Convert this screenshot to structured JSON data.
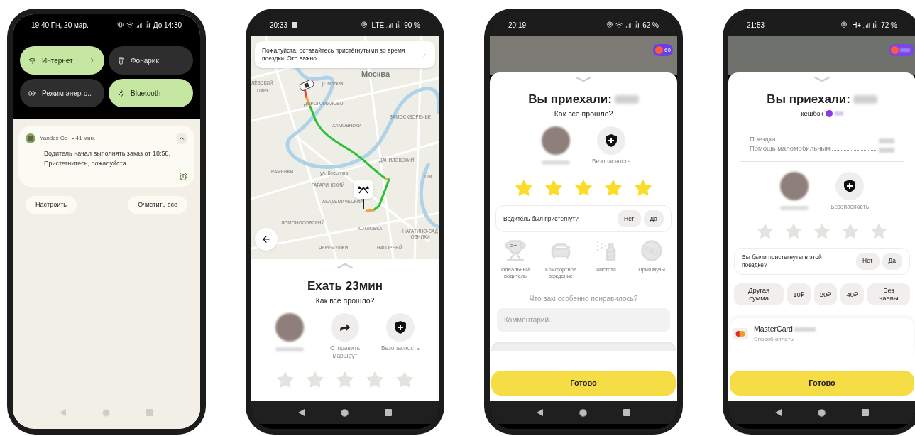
{
  "screens": [
    {
      "kind": "notification_shade",
      "status_bar": {
        "time": "19:40 Пн, 20 мар.",
        "battery": "До 14:30"
      },
      "tiles": [
        {
          "label": "Интернет",
          "on": true
        },
        {
          "label": "Фонарик",
          "on": false
        },
        {
          "label": "Режим энерго..",
          "on": false
        },
        {
          "label": "Bluetooth",
          "on": true
        }
      ],
      "notification": {
        "app": "Yandex Go",
        "age": "• 41 мин.",
        "text": "Водитель начал выполнять заказ от 18:58. Пристегнитесь, пожалуйста"
      },
      "buttons": [
        "Настроить",
        "Очистить все"
      ]
    },
    {
      "kind": "trip_map",
      "status_bar": {
        "time": "20:33",
        "network": "LTE",
        "battery": "90 %"
      },
      "banner": "Пожалуйста, оставайтесь пристёгнутыми во время поездки. Это важно",
      "map_labels": [
        "Москва",
        "ЛЁВСКИЙ",
        "р. Москва",
        "ПАРК",
        "ДОРОГОМИЛОВО",
        "ЗАМОСКВОРЕЧЬЕ",
        "ХАМОВНИКИ",
        "ДАНИЛОВСКИЙ",
        "РАМЕНКИ",
        "ул. Косыгина",
        "ТТК",
        "ГАГАРИНСКИЙ",
        "АКАДЕМИЧЕСКИЙ",
        "ЛОМОНОСОВСКИЙ",
        "КОТЛОВКА",
        "НАГАТИНО-САДОВНИКИ",
        "ЧЕРЁМУШКИ",
        "НАГОРНЫЙ"
      ],
      "title": "Ехать 23мин",
      "subtitle": "Как всё прошло?",
      "actions": [
        {
          "kind": "driver"
        },
        {
          "kind": "share",
          "label": "Отправить маршрут"
        },
        {
          "kind": "safety",
          "label": "Безопасность"
        }
      ],
      "stars": 0
    },
    {
      "kind": "trip_rating",
      "status_bar": {
        "time": "20:19",
        "battery": "62 %"
      },
      "plus_badge": "60",
      "title": "Вы приехали:",
      "subtitle": "Как всё прошло?",
      "actions": [
        {
          "kind": "driver"
        },
        {
          "kind": "safety",
          "label": "Безопасность"
        }
      ],
      "stars": 5,
      "seatbelt": {
        "question": "Водитель был пристёгнут?",
        "options": [
          "Нет",
          "Да"
        ]
      },
      "compliments": [
        {
          "label": "Идеальный водитель",
          "badge": "5+"
        },
        {
          "label": "Комфортное вождение"
        },
        {
          "label": "Чистота"
        },
        {
          "label": "Прия музы"
        }
      ],
      "prompt": "Что вам особенно понравилось?",
      "comment": {
        "placeholder": "Комментарий..."
      },
      "done": "Готово"
    },
    {
      "kind": "trip_tips",
      "status_bar": {
        "time": "21:53",
        "network": "H+",
        "battery": "72 %"
      },
      "title": "Вы приехали:",
      "cashback": "кешбэк",
      "receipt": [
        {
          "label": "Поездка"
        },
        {
          "label": "Помощь маломобильным"
        }
      ],
      "actions": [
        {
          "kind": "driver"
        },
        {
          "kind": "safety",
          "label": "Безопасность"
        }
      ],
      "stars": 0,
      "seatbelt": {
        "question": "Вы были пристегнуты в этой поездке?",
        "options": [
          "Нет",
          "Да"
        ]
      },
      "tips": [
        "Другая сумма",
        "10₽",
        "20₽",
        "40₽",
        "Без чаевы"
      ],
      "payment": {
        "name": "MasterCard",
        "subtitle": "Способ оплаты"
      },
      "done": "Готово"
    }
  ]
}
